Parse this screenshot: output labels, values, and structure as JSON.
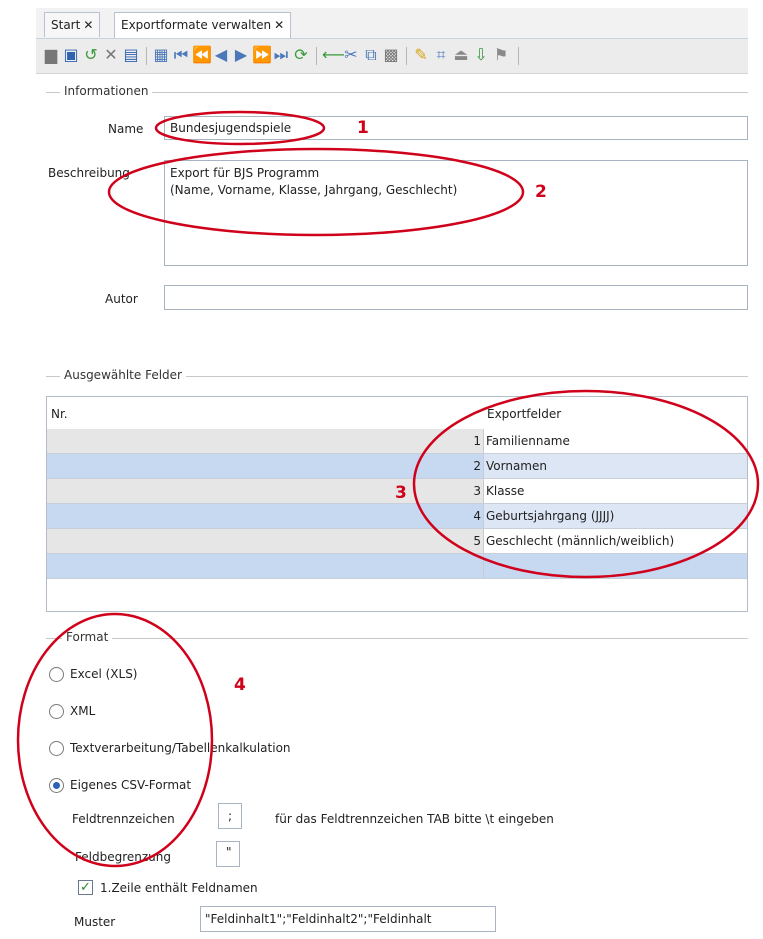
{
  "tabs": [
    {
      "label": "Start",
      "close": "✕"
    },
    {
      "label": "Exportformate verwalten",
      "close": "✕"
    }
  ],
  "toolbar": {
    "icons": [
      "save-icon",
      "save-all-icon",
      "undo-icon",
      "delete-icon",
      "edit-icon",
      "copy-record-icon",
      "first-icon",
      "previous-page-icon",
      "previous-icon",
      "next-icon",
      "next-page-icon",
      "last-icon",
      "refresh-icon",
      "back-arrow-icon",
      "cut-icon",
      "copy-icon",
      "paste-icon",
      "clean-icon",
      "select-icon",
      "export-icon",
      "import-icon",
      "pin-icon"
    ]
  },
  "informationen": {
    "group_label": "Informationen",
    "name_label": "Name",
    "name_value": "Bundesjugendspiele",
    "beschreibung_label": "Beschreibung",
    "beschreibung_line1": "Export für BJS Programm",
    "beschreibung_line2": "(Name, Vorname, Klasse, Jahrgang, Geschlecht)",
    "autor_label": "Autor",
    "autor_value": ""
  },
  "felder": {
    "group_label": "Ausgewählte Felder",
    "col_nr": "Nr.",
    "col_export": "Exportfelder",
    "rows": [
      {
        "nr": "1",
        "field": "Familienname"
      },
      {
        "nr": "2",
        "field": "Vornamen"
      },
      {
        "nr": "3",
        "field": "Klasse"
      },
      {
        "nr": "4",
        "field": "Geburtsjahrgang (JJJJ)"
      },
      {
        "nr": "5",
        "field": "Geschlecht (männlich/weiblich)"
      },
      {
        "nr": "",
        "field": ""
      }
    ]
  },
  "format": {
    "group_label": "Format",
    "options": [
      {
        "label": "Excel (XLS)",
        "selected": false
      },
      {
        "label": "XML",
        "selected": false
      },
      {
        "label": "Textverarbeitung/Tabellenkalkulation",
        "selected": false
      },
      {
        "label": "Eigenes CSV-Format",
        "selected": true
      }
    ],
    "feldtrenn_label": "Feldtrennzeichen",
    "feldtrenn_value": ";",
    "feldtrenn_hint": "für das Feldtrennzeichen TAB bitte \\t eingeben",
    "feldbegr_label": "Feldbegrenzung",
    "feldbegr_value": "\"",
    "header_row_label": "1.Zeile enthält Feldnamen",
    "header_row_checked": true,
    "muster_label": "Muster",
    "muster_value": "\"Feldinhalt1\";\"Feldinhalt2\";\"Feldinhalt"
  },
  "annotations": [
    "1",
    "2",
    "3",
    "4"
  ],
  "colors": {
    "annotation": "#d0021b",
    "selected_row": "#c6d9f1",
    "accent": "#2c63b5"
  }
}
